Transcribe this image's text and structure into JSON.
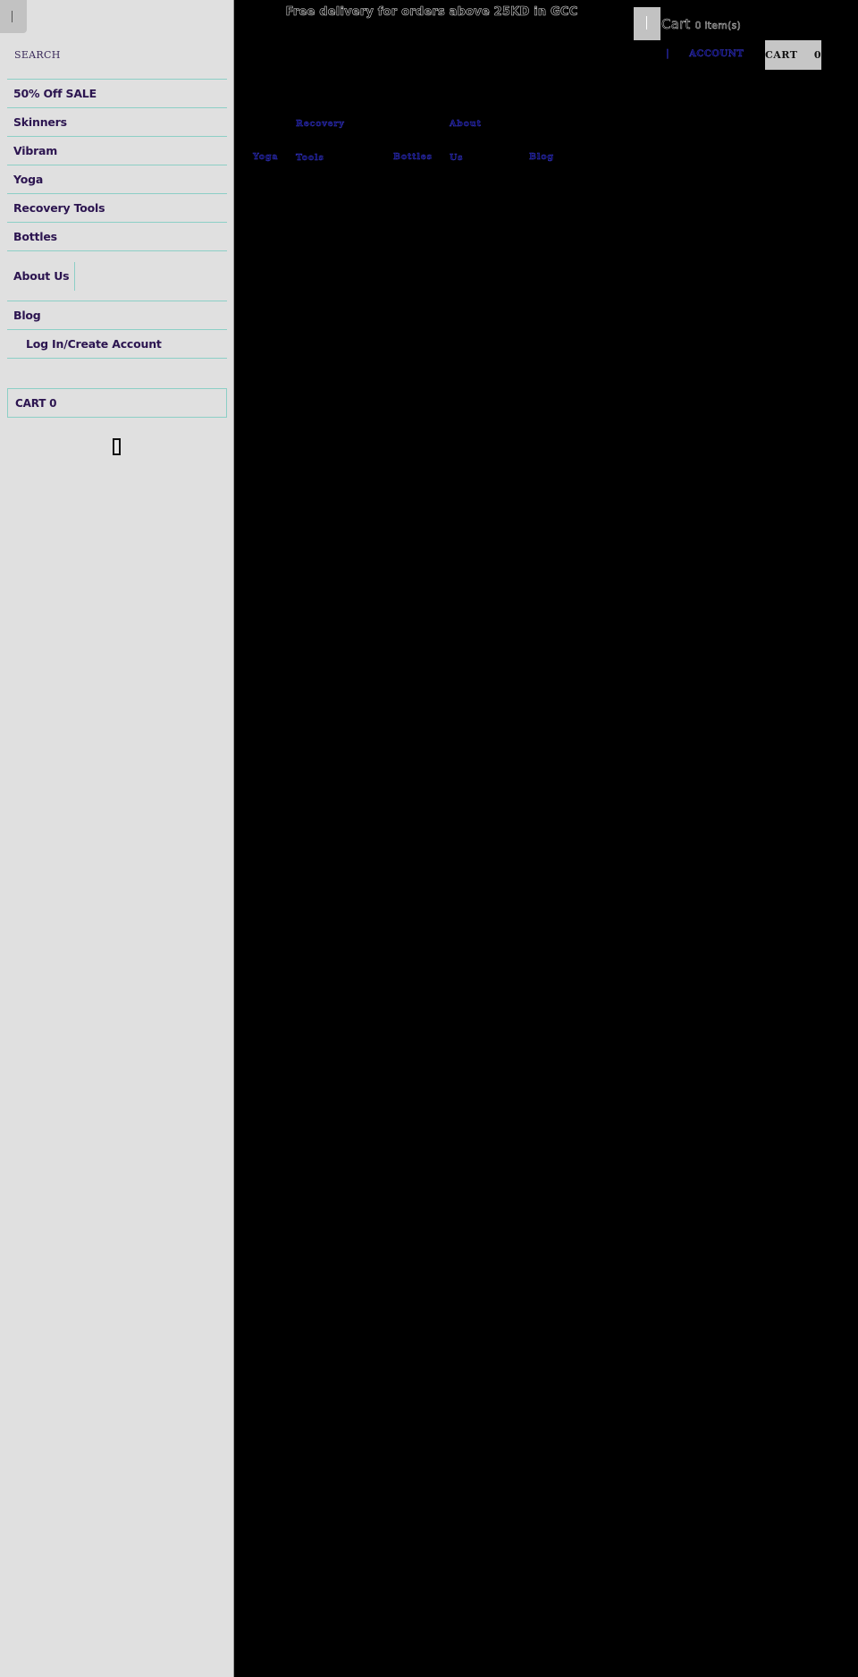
{
  "sidebar": {
    "close_button_label": "Close menu",
    "search": {
      "placeholder": "SEARCH",
      "value": ""
    },
    "menu_items": [
      {
        "label": "50% Off SALE"
      },
      {
        "label": "Skinners"
      },
      {
        "label": "Vibram"
      },
      {
        "label": "Yoga"
      },
      {
        "label": "Recovery Tools"
      },
      {
        "label": "Bottles"
      },
      {
        "label": "About Us"
      },
      {
        "label": "Blog"
      },
      {
        "label": "Log In/Create Account"
      }
    ],
    "cart_label": "CART 0",
    "placeholder_icon": "missing-glyph-icon"
  },
  "header": {
    "announcement": "Free delivery for orders above 25KD in GCC",
    "cart_summary": {
      "label": "Cart",
      "count_text": "0 item(s)"
    },
    "account": {
      "separator": "|",
      "label": "ACCOUNT"
    },
    "cart_button": {
      "label": "CART",
      "count": "0"
    }
  },
  "main_nav": {
    "items": [
      {
        "line1": "",
        "line2": "Yoga"
      },
      {
        "line1": "Recovery",
        "line2": "Tools"
      },
      {
        "line1": "",
        "line2": "Bottles"
      },
      {
        "line1": "About",
        "line2": "Us"
      },
      {
        "line1": "",
        "line2": "Blog"
      }
    ]
  },
  "colors": {
    "sidebar_bg": "#e0e0e0",
    "menu_text": "#2c1550",
    "divider": "#8ccfc6",
    "main_bg": "#000000",
    "nav_link": "#3b3bd0"
  }
}
